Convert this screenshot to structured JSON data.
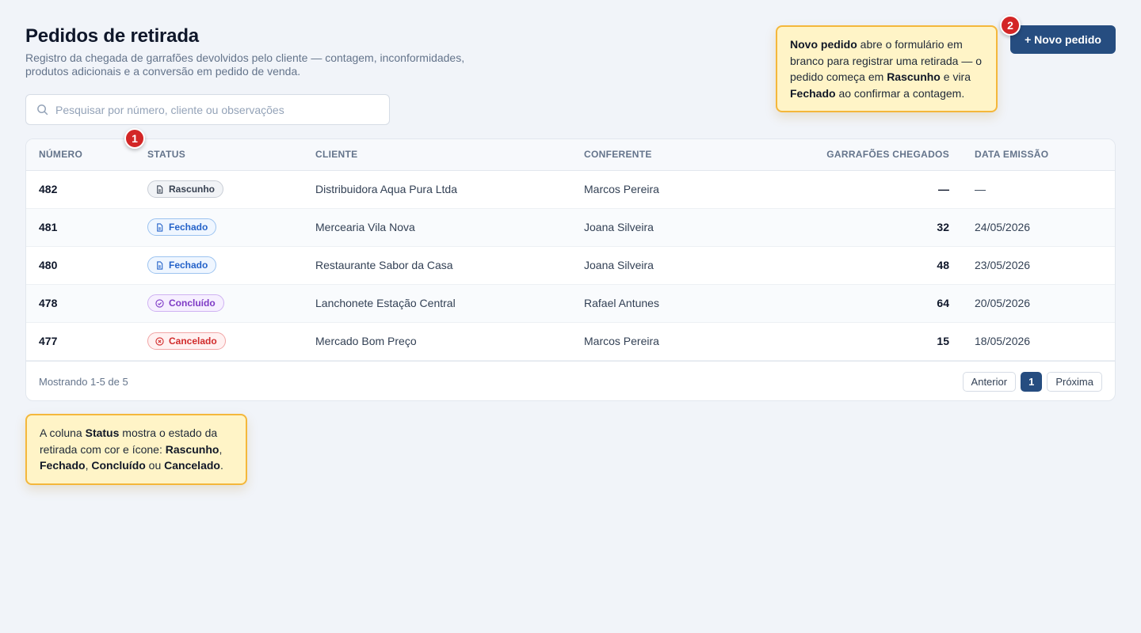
{
  "page": {
    "title": "Pedidos de retirada",
    "subtitle": "Registro da chegada de garrafões devolvidos pelo cliente — contagem, inconformidades, produtos adicionais e a conversão em pedido de venda."
  },
  "search": {
    "placeholder": "Pesquisar por número, cliente ou observações",
    "value": "",
    "icon": "search-icon"
  },
  "actions": {
    "new_label": "+ Novo pedido"
  },
  "table": {
    "columns": [
      "Número",
      "Status",
      "Cliente",
      "Conferente",
      "Garrafões chegados",
      "Data emissão"
    ],
    "rows": [
      {
        "numero": "482",
        "status": "Rascunho",
        "cliente": "Distribuidora Aqua Pura Ltda",
        "conferente": "Marcos Pereira",
        "garrafoes": "—",
        "data": "—"
      },
      {
        "numero": "481",
        "status": "Fechado",
        "cliente": "Mercearia Vila Nova",
        "conferente": "Joana Silveira",
        "garrafoes": "32",
        "data": "24/05/2026"
      },
      {
        "numero": "480",
        "status": "Fechado",
        "cliente": "Restaurante Sabor da Casa",
        "conferente": "Joana Silveira",
        "garrafoes": "48",
        "data": "23/05/2026"
      },
      {
        "numero": "478",
        "status": "Concluído",
        "cliente": "Lanchonete Estação Central",
        "conferente": "Rafael Antunes",
        "garrafoes": "64",
        "data": "20/05/2026"
      },
      {
        "numero": "477",
        "status": "Cancelado",
        "cliente": "Mercado Bom Preço",
        "conferente": "Marcos Pereira",
        "garrafoes": "15",
        "data": "18/05/2026"
      }
    ],
    "status_colors": {
      "Rascunho": "#374151",
      "Fechado": "#2563c9",
      "Concluído": "#7e3ac5",
      "Cancelado": "#d12b2b"
    }
  },
  "pagination": {
    "info": "Mostrando 1-5 de 5",
    "prev": "Anterior",
    "current": "1",
    "next": "Próxima"
  },
  "annotations": {
    "marker_1": "1",
    "marker_2": "2",
    "tip_1": {
      "t1": "A coluna ",
      "b1": "Status",
      "t2": " mostra o estado da retirada com cor e ícone: ",
      "b2": "Rascunho",
      "t3": ", ",
      "b3": "Fechado",
      "t4": ", ",
      "b4": "Concluído",
      "t5": " ou ",
      "b5": "Cancelado",
      "t6": "."
    },
    "tip_2": {
      "b1": "Novo pedido",
      "t1": " abre o formulário em branco para registrar uma retirada — o pedido começa em ",
      "b2": "Rascunho",
      "t2": " e vira ",
      "b3": "Fechado",
      "t3": " ao confirmar a contagem."
    }
  },
  "colors": {
    "primary": "#264d80",
    "background": "#f1f4f9",
    "tooltip_bg": "#fff4c7",
    "tooltip_border": "#f4b73b",
    "marker": "#d32626"
  }
}
